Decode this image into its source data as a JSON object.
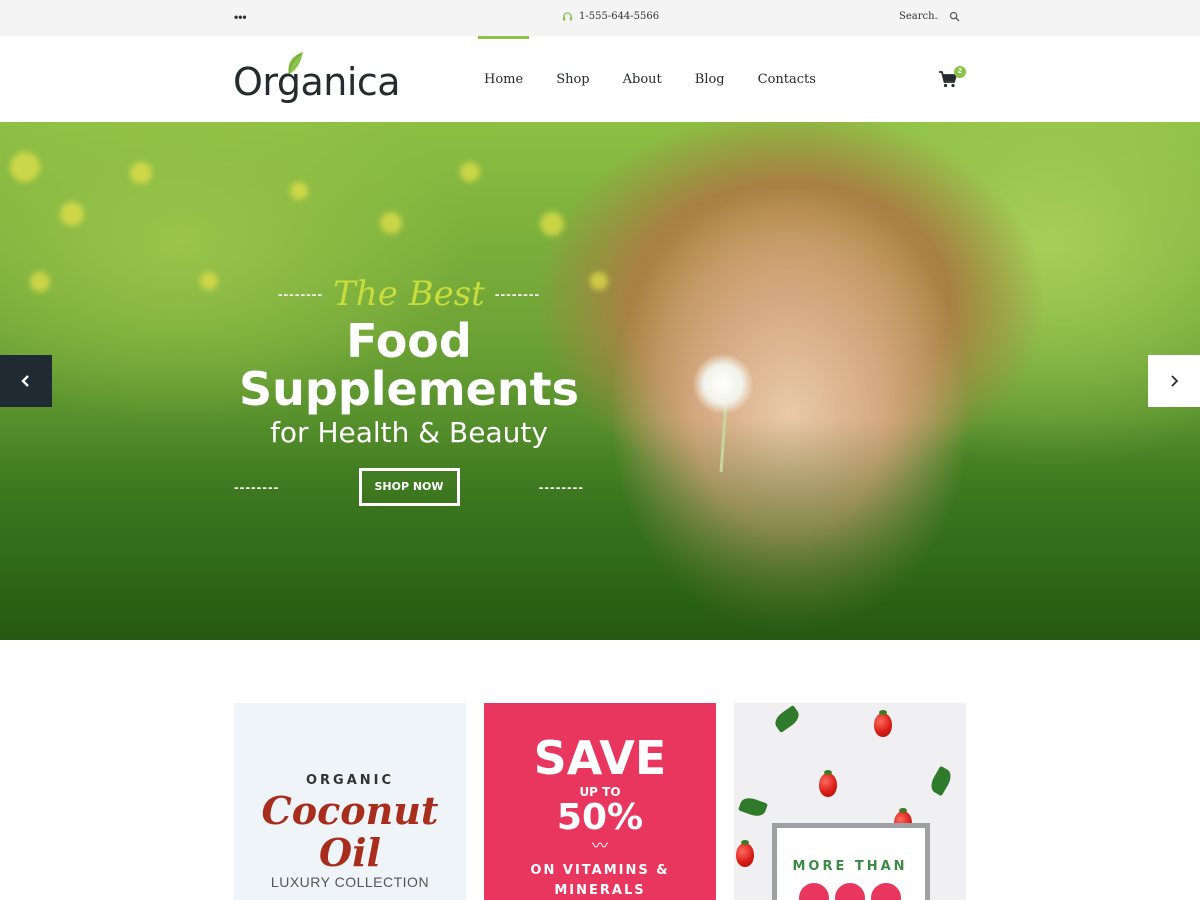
{
  "topbar": {
    "menu_dots": "•••",
    "phone": "1-555-644-5566",
    "search_placeholder": "Search..."
  },
  "header": {
    "logo": "Organica",
    "nav": [
      {
        "label": "Home",
        "active": true
      },
      {
        "label": "Shop",
        "active": false
      },
      {
        "label": "About",
        "active": false
      },
      {
        "label": "Blog",
        "active": false
      },
      {
        "label": "Contacts",
        "active": false
      }
    ],
    "cart_count": "2"
  },
  "hero": {
    "tagline": "The Best",
    "headline_line1": "Food",
    "headline_line2": "Supplements",
    "subline": "for Health & Beauty",
    "cta_label": "SHOP NOW",
    "dashes": "--------"
  },
  "promos": {
    "card1": {
      "small": "ORGANIC",
      "script_line1": "Coconut",
      "script_line2": "Oil",
      "tagline": "LUXURY COLLECTION"
    },
    "card2": {
      "save": "SAVE",
      "upto": "UP TO",
      "percent": "50%",
      "mustache": "〰",
      "line1": "ON VITAMINS &",
      "line2": "MINERALS"
    },
    "card3": {
      "more": "MORE THAN"
    }
  },
  "colors": {
    "accent_green": "#8bc34a",
    "tagline_lime": "#c8dc3c",
    "promo_pink": "#e9365e",
    "coconut_red": "#a82d1d",
    "dark_text": "#262b30"
  }
}
